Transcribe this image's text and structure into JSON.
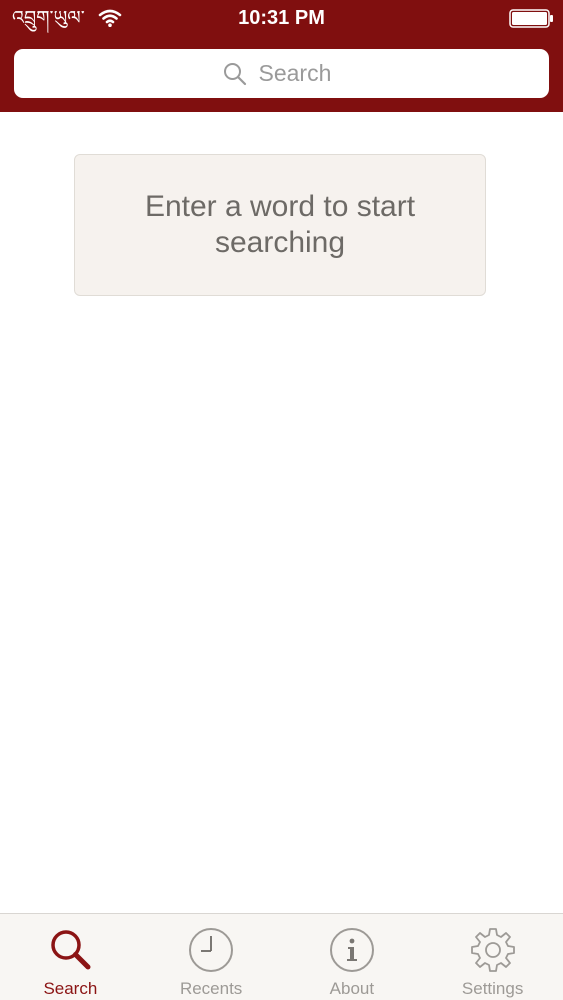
{
  "status_bar": {
    "carrier": "འབྲུག་ཡུལ་",
    "time": "10:31 PM",
    "wifi_icon": "wifi-icon",
    "battery_icon": "battery-full-icon"
  },
  "search": {
    "placeholder": "Search",
    "value": "",
    "icon": "search-icon"
  },
  "empty_state": {
    "message": "Enter a word to start searching"
  },
  "tabs": [
    {
      "label": "Search",
      "icon": "search-icon",
      "active": true
    },
    {
      "label": "Recents",
      "icon": "clock-icon",
      "active": false
    },
    {
      "label": "About",
      "icon": "info-icon",
      "active": false
    },
    {
      "label": "Settings",
      "icon": "gear-icon",
      "active": false
    }
  ],
  "colors": {
    "brand": "#800f0f",
    "active_tab": "#8b1414",
    "inactive_tab": "#9d9a96",
    "card_background": "#f6f2ee"
  }
}
